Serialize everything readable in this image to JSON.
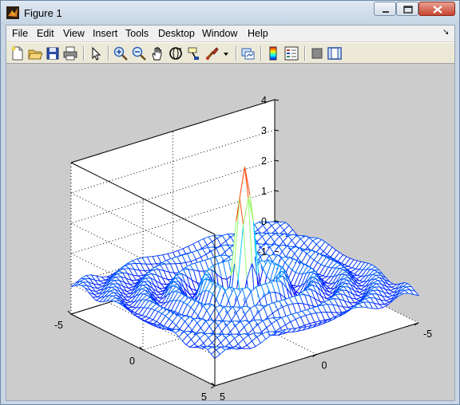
{
  "window": {
    "title": "Figure 1"
  },
  "menu": {
    "items": [
      "File",
      "Edit",
      "View",
      "Insert",
      "Tools",
      "Desktop",
      "Window",
      "Help"
    ],
    "dock_glyph": "↘"
  },
  "toolbar": {
    "buttons": [
      "new-figure-icon",
      "open-file-icon",
      "save-figure-icon",
      "print-figure-icon",
      "edit-plot-arrow-icon",
      "zoom-in-icon",
      "zoom-out-icon",
      "pan-hand-icon",
      "rotate-3d-icon",
      "data-cursor-icon",
      "brush-icon",
      "link-plot-icon",
      "insert-colorbar-icon",
      "insert-legend-icon",
      "hide-plot-tools-icon",
      "show-plot-tools-icon"
    ]
  },
  "plot": {
    "type": "3d-mesh",
    "function": "sinc",
    "z_ticks": [
      "-1",
      "0",
      "1",
      "2",
      "3",
      "4"
    ],
    "x_ticks": [
      "-5",
      "0",
      "5"
    ],
    "y_ticks": [
      "-5",
      "0",
      "5"
    ],
    "xlim": [
      -5,
      5
    ],
    "ylim": [
      -5,
      5
    ],
    "zlim": [
      -1,
      4
    ],
    "grid": true,
    "box": true,
    "colormap": "jet"
  },
  "colors": {
    "figure_background": "#cccccc",
    "axes_background": "#ffffff",
    "mesh_low": "#0000ff",
    "mesh_high": "#bf0000"
  }
}
